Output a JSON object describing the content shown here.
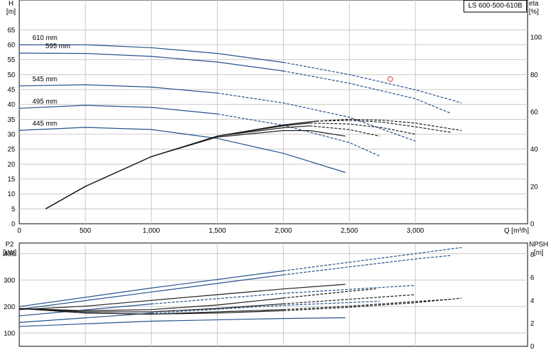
{
  "chart_data": [
    {
      "type": "line",
      "title": "LS 600-500-610B",
      "xlabel": "Q [m³/h]",
      "ylabel": "H\n[m]",
      "y2label": "eta\n[%]",
      "xlim": [
        0,
        3850
      ],
      "ylim": [
        0,
        75
      ],
      "y2lim": [
        0,
        120
      ],
      "grid": true,
      "x_ticks": [
        "0",
        "500",
        "1,000",
        "1,500",
        "2,000",
        "2,500",
        "3,000"
      ],
      "y_ticks": [
        "0",
        "5",
        "10",
        "15",
        "20",
        "25",
        "30",
        "35",
        "40",
        "45",
        "50",
        "55",
        "60",
        "65"
      ],
      "y2_ticks": [
        "0",
        "20",
        "40",
        "60",
        "80",
        "100"
      ],
      "operating_point": {
        "x": 2810,
        "y": 48.5,
        "color": "#e03030"
      },
      "series": [
        {
          "name": "610 mm",
          "axis": "H",
          "color": "#1f4e8c",
          "solid_until": 2100,
          "x": [
            0,
            500,
            1000,
            1500,
            2000,
            2500,
            3000,
            3350
          ],
          "values": [
            60.0,
            60.0,
            59.0,
            57.1,
            54.1,
            50.0,
            44.9,
            40.5
          ]
        },
        {
          "name": "595 mm",
          "axis": "H",
          "color": "#1f4e8c",
          "solid_until": 2100,
          "x": [
            0,
            500,
            1000,
            1500,
            2000,
            2500,
            3000,
            3270
          ],
          "values": [
            57.2,
            57.1,
            56.1,
            54.2,
            51.2,
            47.1,
            41.9,
            37.0
          ]
        },
        {
          "name": "545 mm",
          "axis": "H",
          "color": "#1f4e8c",
          "solid_until": 1900,
          "x": [
            0,
            500,
            1000,
            1500,
            2000,
            2500,
            3000
          ],
          "values": [
            46.2,
            46.6,
            45.8,
            43.8,
            40.5,
            35.7,
            27.7
          ]
        },
        {
          "name": "495 mm",
          "axis": "H",
          "color": "#1f4e8c",
          "solid_until": 1800,
          "x": [
            0,
            500,
            1000,
            1500,
            2000,
            2500,
            2730
          ],
          "values": [
            38.7,
            39.7,
            39.0,
            36.8,
            33.0,
            27.2,
            22.7
          ]
        },
        {
          "name": "445 mm",
          "axis": "H",
          "color": "#1f4e8c",
          "solid_until": 2470,
          "x": [
            0,
            500,
            1000,
            1500,
            2000,
            2470
          ],
          "values": [
            31.3,
            32.3,
            31.6,
            28.6,
            23.6,
            17.2
          ]
        },
        {
          "name": "",
          "axis": "eta",
          "color": "#1a1a1a",
          "solid_until": 2250,
          "x": [
            200,
            500,
            1000,
            1500,
            2000,
            2250,
            2500,
            2750,
            3000,
            3350
          ],
          "values": [
            8,
            20,
            36,
            47,
            53,
            55,
            56,
            55.5,
            54,
            50
          ]
        },
        {
          "name": "",
          "axis": "eta",
          "color": "#1a1a1a",
          "solid_until": 2250,
          "x": [
            200,
            500,
            1000,
            1500,
            2000,
            2250,
            2500,
            2750,
            3000,
            3270
          ],
          "values": [
            8,
            20,
            36,
            47,
            53,
            55,
            55.5,
            54.5,
            52,
            49
          ]
        },
        {
          "name": "",
          "axis": "eta",
          "color": "#1a1a1a",
          "solid_until": 2200,
          "x": [
            200,
            500,
            1000,
            1500,
            2000,
            2200,
            2500,
            2750,
            3000
          ],
          "values": [
            8,
            20,
            36,
            47,
            52.5,
            54,
            53.5,
            51.5,
            48
          ]
        },
        {
          "name": "",
          "axis": "eta",
          "color": "#1a1a1a",
          "solid_until": 2200,
          "x": [
            200,
            500,
            1000,
            1500,
            2000,
            2200,
            2500,
            2730
          ],
          "values": [
            8,
            20,
            36,
            47,
            51.5,
            52.5,
            50.5,
            47
          ]
        },
        {
          "name": "",
          "axis": "eta",
          "color": "#1a1a1a",
          "solid_until": 2470,
          "x": [
            200,
            500,
            1000,
            1500,
            2000,
            2200,
            2470
          ],
          "values": [
            8,
            20,
            36,
            46.5,
            50,
            50,
            47
          ]
        }
      ]
    },
    {
      "type": "line",
      "xlim": [
        0,
        3850
      ],
      "ylim": [
        50,
        440
      ],
      "y2lim": [
        0,
        9
      ],
      "ylabel": "P2\n[kW]",
      "y2label": "NPSH\n[m]",
      "grid": true,
      "y_ticks": [
        "100",
        "200",
        "300",
        "400"
      ],
      "y2_ticks": [
        "0",
        "2",
        "4",
        "6",
        "8"
      ],
      "series": [
        {
          "axis": "P2",
          "color": "#1f4e8c",
          "solid_until": 2100,
          "x": [
            0,
            1000,
            2000,
            3000,
            3350
          ],
          "values": [
            200,
            270,
            335,
            400,
            423
          ]
        },
        {
          "axis": "P2",
          "color": "#1f4e8c",
          "solid_until": 2100,
          "x": [
            0,
            1000,
            2000,
            3000,
            3270
          ],
          "values": [
            190,
            255,
            320,
            380,
            393
          ]
        },
        {
          "axis": "P2",
          "color": "#1f4e8c",
          "solid_until": 1900,
          "x": [
            0,
            1000,
            2000,
            3000
          ],
          "values": [
            165,
            210,
            250,
            280
          ]
        },
        {
          "axis": "P2",
          "color": "#1f4e8c",
          "solid_until": 1800,
          "x": [
            0,
            1000,
            2000,
            2730
          ],
          "values": [
            140,
            175,
            205,
            220
          ]
        },
        {
          "axis": "P2",
          "color": "#1f4e8c",
          "solid_until": 2470,
          "x": [
            0,
            1000,
            2000,
            2470
          ],
          "values": [
            125,
            145,
            155,
            158
          ]
        },
        {
          "axis": "NPSH",
          "color": "#1a1a1a",
          "solid_until": 2470,
          "x": [
            0,
            500,
            1000,
            1500,
            2000,
            2470
          ],
          "values": [
            3.2,
            3.5,
            4.0,
            4.5,
            5.0,
            5.4
          ]
        },
        {
          "axis": "NPSH",
          "color": "#1a1a1a",
          "solid_until": 2100,
          "x": [
            0,
            500,
            1000,
            1500,
            2000,
            2500,
            2700
          ],
          "values": [
            3.3,
            3.1,
            3.2,
            3.6,
            4.2,
            4.8,
            5.0
          ]
        },
        {
          "axis": "NPSH",
          "color": "#1a1a1a",
          "solid_until": 2100,
          "x": [
            0,
            500,
            1000,
            1500,
            2000,
            2500,
            3000
          ],
          "values": [
            3.3,
            3.0,
            3.0,
            3.3,
            3.7,
            4.1,
            4.5
          ]
        },
        {
          "axis": "NPSH",
          "color": "#1a1a1a",
          "solid_until": 2100,
          "x": [
            0,
            500,
            1000,
            1500,
            2000,
            2500,
            3000,
            3270
          ],
          "values": [
            3.3,
            2.9,
            2.8,
            3.0,
            3.2,
            3.5,
            3.9,
            4.1
          ]
        },
        {
          "axis": "NPSH",
          "color": "#1a1a1a",
          "solid_until": 2100,
          "x": [
            0,
            500,
            1000,
            1500,
            2000,
            2500,
            3000,
            3350
          ],
          "values": [
            3.3,
            2.9,
            2.8,
            2.9,
            3.1,
            3.4,
            3.8,
            4.2
          ]
        }
      ]
    }
  ]
}
